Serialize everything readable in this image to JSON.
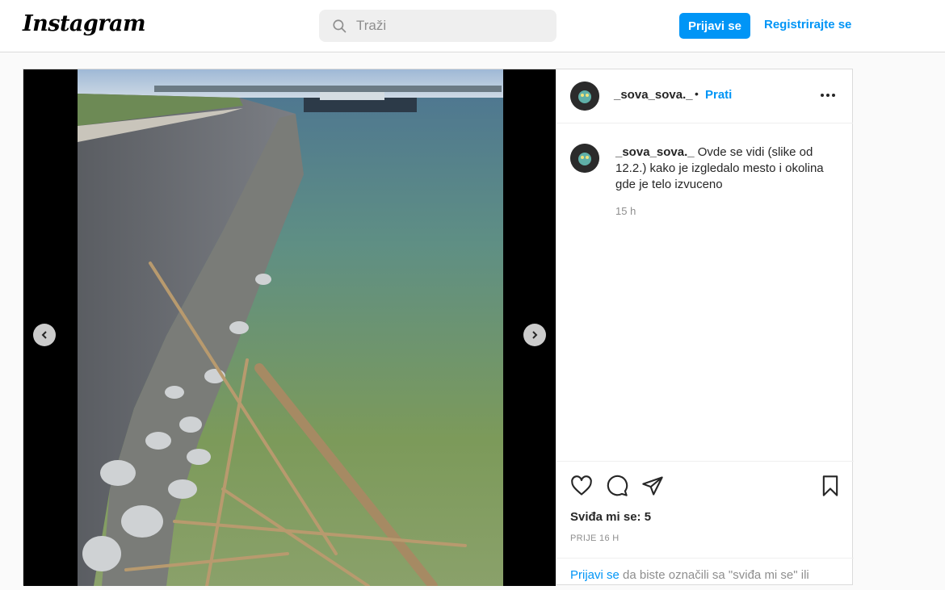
{
  "header": {
    "logo": "Instagram",
    "search_placeholder": "Traži",
    "login_label": "Prijavi se",
    "register_label": "Registrirajte se"
  },
  "post": {
    "username": "_sova_sova._",
    "follow_label": "Prati",
    "caption_username": "_sova_sova._",
    "caption_text": "Ovde se vidi (slike od 12.2.) kako je izgledalo mesto i okolina gde je telo izvuceno",
    "caption_time": "15 h",
    "likes": "Sviđa mi se: 5",
    "date": "PRIJE 16 H",
    "login_prompt_link": "Prijavi se",
    "login_prompt_text": " da biste označili sa \"sviđa mi se\" ili"
  },
  "icons": {
    "search": "search-icon",
    "prev": "chevron-left-icon",
    "next": "chevron-right-icon",
    "more": "more-horizontal-icon",
    "like": "heart-icon",
    "comment": "comment-icon",
    "share": "share-icon",
    "save": "bookmark-icon"
  },
  "colors": {
    "accent": "#0095f6",
    "muted": "#8e8e8e",
    "border": "#dbdbdb"
  }
}
